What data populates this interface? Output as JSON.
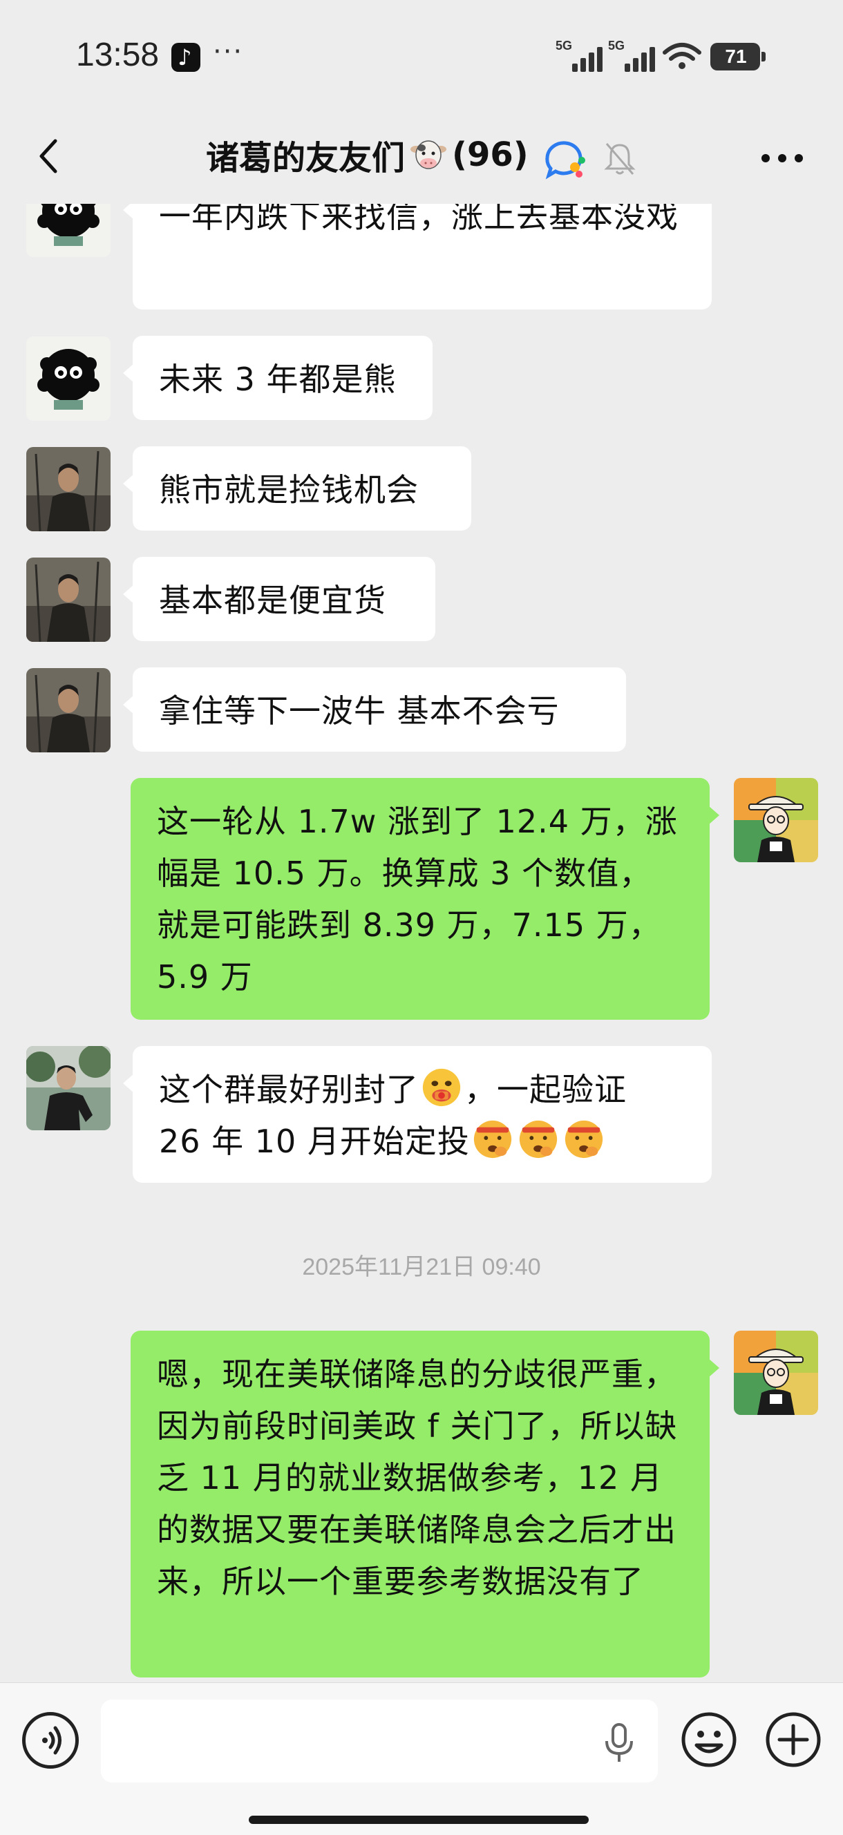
{
  "status_bar": {
    "time": "13:58",
    "more": "···",
    "signal_1": "5G",
    "signal_2": "5G",
    "battery": "71",
    "app_icon": "tiktok-icon"
  },
  "header": {
    "title": "诸葛的友友们",
    "count": "(96)",
    "icons": [
      "back-icon",
      "cow-emoji-icon",
      "ai-assistant-icon",
      "mute-bell-icon",
      "more-icon"
    ]
  },
  "messages": [
    {
      "side": "in",
      "avatar": "soot-sprite",
      "text": "一年内跌下来找信，涨上去基本没戏"
    },
    {
      "side": "in",
      "avatar": "soot-sprite",
      "text": "未来 3 年都是熊"
    },
    {
      "side": "in",
      "avatar": "warrior",
      "text": "熊市就是捡钱机会"
    },
    {
      "side": "in",
      "avatar": "warrior",
      "text": "基本都是便宜货"
    },
    {
      "side": "in",
      "avatar": "warrior",
      "text": "拿住等下一波牛 基本不会亏"
    },
    {
      "side": "out",
      "avatar": "cartoon-hat",
      "text": "这一轮从 1.7w 涨到了 12.4 万，涨幅是 10.5 万。换算成 3 个数值，就是可能跌到 8.39 万，7.15 万，5.9 万"
    },
    {
      "side": "in",
      "avatar": "man-photo",
      "text_a": "这个群最好别封了",
      "text_b": "，一起验证",
      "text_c": "26 年 10 月开始定投",
      "emojis": [
        "money-mouth-emoji",
        "shushing-emoji",
        "shushing-emoji",
        "shushing-emoji"
      ]
    },
    {
      "timestamp": "2025年11月21日 09:40"
    },
    {
      "side": "out",
      "avatar": "cartoon-hat",
      "text": "嗯，现在美联储降息的分歧很严重，因为前段时间美政 f 关门了，所以缺乏 11 月的就业数据做参考，12 月的数据又要在美联储降息会之后才出来，所以一个重要参考数据没有了"
    }
  ],
  "input_bar": {
    "placeholder": "",
    "icons": [
      "voice-icon",
      "mic-icon",
      "emoji-icon",
      "add-icon"
    ]
  },
  "colors": {
    "background": "#ededed",
    "outgoing_bubble": "#95ec69",
    "incoming_bubble": "#ffffff",
    "timestamp_text": "#a8a8a8"
  }
}
